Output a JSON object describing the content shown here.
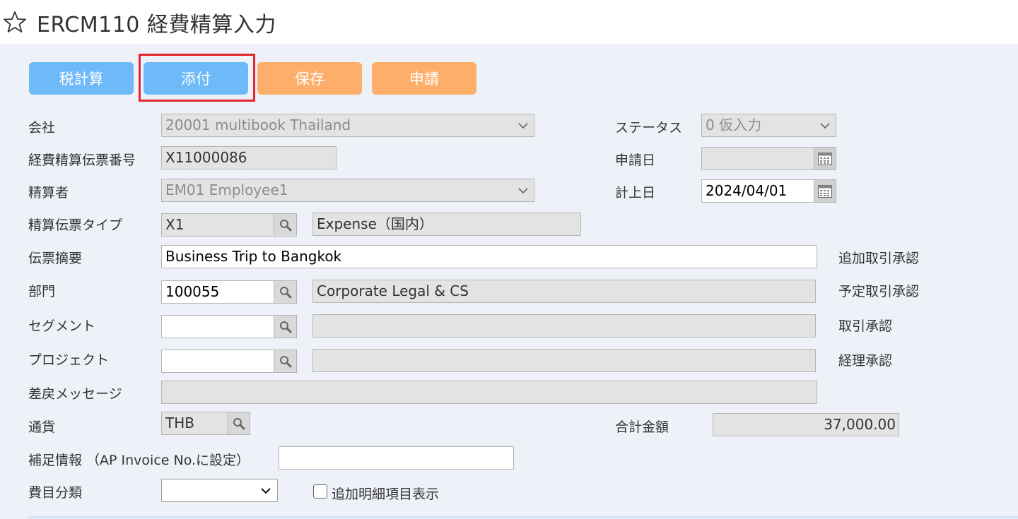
{
  "header": {
    "title": "ERCM110 経費精算入力",
    "star_icon": "star-outline-icon"
  },
  "toolbar": {
    "tax_calc_label": "税計算",
    "attach_label": "添付",
    "save_label": "保存",
    "apply_label": "申請",
    "colors": {
      "blue": "#6eb9f8",
      "orange": "#fdae6b",
      "highlight": "#e3262e"
    }
  },
  "form": {
    "company": {
      "label": "会社",
      "value": "20001 multibook Thailand"
    },
    "status": {
      "label": "ステータス",
      "value": "0 仮入力"
    },
    "voucher_no": {
      "label": "経費精算伝票番号",
      "value": "X11000086"
    },
    "apply_date": {
      "label": "申請日",
      "value": ""
    },
    "settler": {
      "label": "精算者",
      "value": "EM01 Employee1"
    },
    "posting_date": {
      "label": "計上日",
      "value": "2024/04/01"
    },
    "voucher_type": {
      "label": "精算伝票タイプ",
      "code": "X1",
      "name": "Expense（国内）"
    },
    "summary": {
      "label": "伝票摘要",
      "value": "Business Trip to  Bangkok"
    },
    "department": {
      "label": "部門",
      "code": "100055",
      "name": "Corporate Legal & CS"
    },
    "segment": {
      "label": "セグメント",
      "code": "",
      "name": ""
    },
    "project": {
      "label": "プロジェクト",
      "code": "",
      "name": ""
    },
    "return_message": {
      "label": "差戻メッセージ",
      "value": ""
    },
    "currency": {
      "label": "通貨",
      "code": "THB"
    },
    "total_amount": {
      "label": "合計金額",
      "value": "37,000.00"
    },
    "supplement": {
      "label": "補足情報 （AP Invoice No.に設定）",
      "value": ""
    },
    "expense_category": {
      "label": "費目分類",
      "value": ""
    },
    "show_extra_details": {
      "label": "追加明細項目表示",
      "checked": false
    }
  },
  "approvals": {
    "additional": "追加取引承認",
    "scheduled": "予定取引承認",
    "transaction": "取引承認",
    "accounting": "経理承認"
  }
}
